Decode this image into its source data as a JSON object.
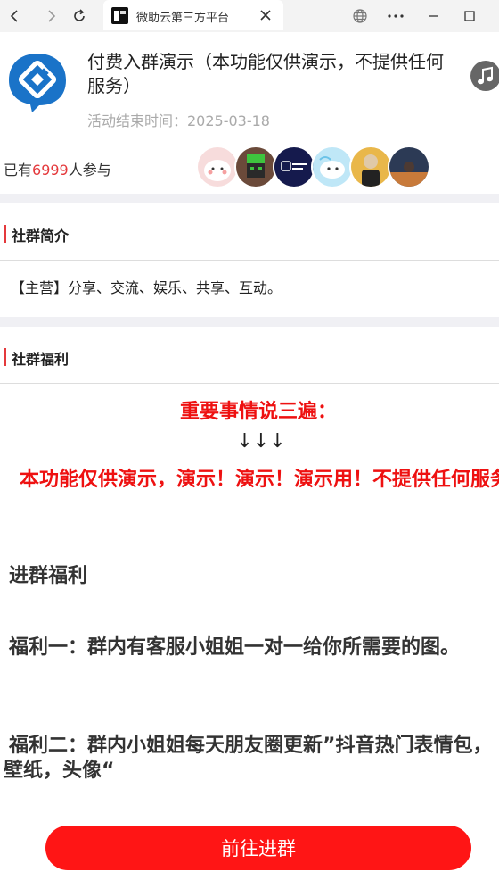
{
  "browser": {
    "tab_title": "微助云第三方平台",
    "icons": [
      "back-icon",
      "forward-icon",
      "refresh-icon",
      "close-icon",
      "globe-icon",
      "more-icon",
      "minimize-icon",
      "maximize-icon"
    ]
  },
  "header": {
    "title": "付费入群演示（本功能仅供演示，不提供任何服务）",
    "end_time": "活动结束时间：2025-03-18"
  },
  "participants": {
    "prefix": "已有",
    "count": "6999",
    "suffix": "人参与",
    "avatars": [
      "avatar-1",
      "avatar-2",
      "avatar-3",
      "avatar-4",
      "avatar-5",
      "avatar-6"
    ]
  },
  "intro": {
    "heading": "社群简介",
    "text": "【主营】分享、交流、娱乐、共享、互动。"
  },
  "benefits": {
    "heading": "社群福利",
    "important": "重要事情说三遍：",
    "arrows": "↓↓↓",
    "demo_note": "本功能仅供演示，演示！演示！演示用！不提供任何服务",
    "join_benefits": "进群福利",
    "benefit_one": "福利一：群内有客服小姐姐一对一给你所需要的图。",
    "benefit_two": "福利二：群内小姐姐每天朋友圈更新”抖音热门表情包，壁纸，头像“"
  },
  "actions": {
    "join_button": "前往进群"
  },
  "colors": {
    "accent": "#e4393c",
    "button": "#ff1515",
    "logo_blue": "#1a73c8"
  }
}
